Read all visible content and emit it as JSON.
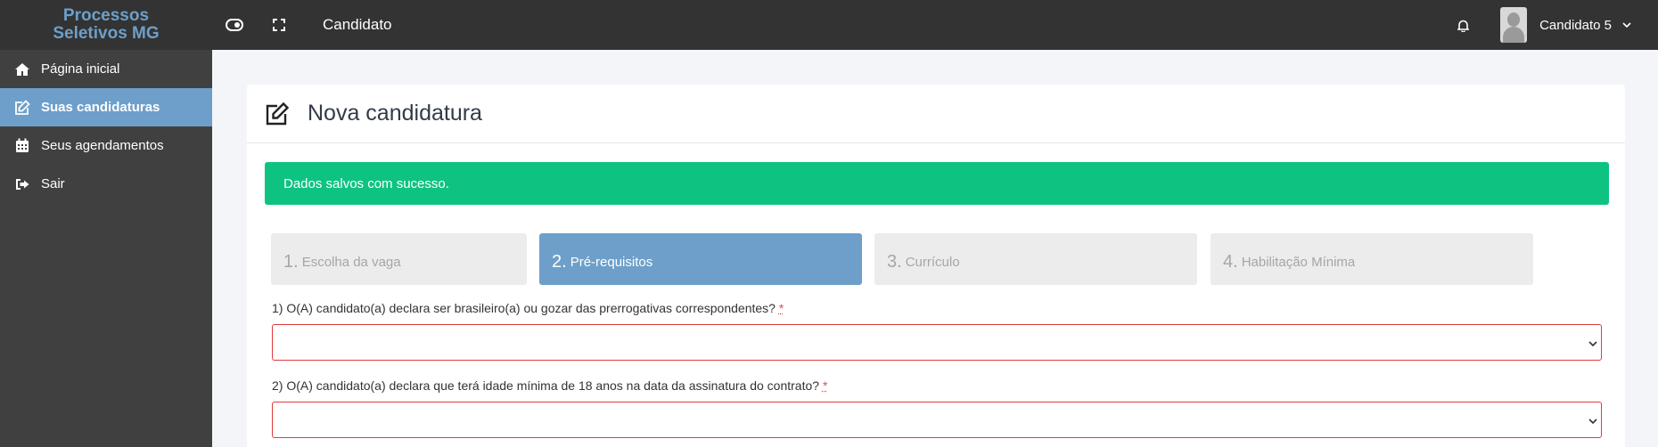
{
  "header": {
    "brand_line1": "Processos",
    "brand_line2": "Seletivos MG",
    "title": "Candidato",
    "user_name": "Candidato 5",
    "icons": [
      "toggle-sidebar-icon",
      "fullscreen-icon",
      "bell-icon",
      "chevron-down-icon"
    ]
  },
  "sidebar": {
    "items": [
      {
        "label": "Página inicial",
        "icon": "home-icon",
        "active": false
      },
      {
        "label": "Suas candidaturas",
        "icon": "edit-icon",
        "active": true
      },
      {
        "label": "Seus agendamentos",
        "icon": "calendar-icon",
        "active": false
      },
      {
        "label": "Sair",
        "icon": "sign-out-icon",
        "active": false
      }
    ]
  },
  "main": {
    "title": "Nova candidatura",
    "alert": "Dados salvos com sucesso.",
    "steps": [
      {
        "num": "1.",
        "label": "Escolha da vaga",
        "active": false
      },
      {
        "num": "2.",
        "label": "Pré-requisitos",
        "active": true
      },
      {
        "num": "3.",
        "label": "Currículo",
        "active": false
      },
      {
        "num": "4.",
        "label": "Habilitação Mínima",
        "active": false
      }
    ],
    "questions": [
      {
        "label": "1) O(A) candidato(a) declara ser brasileiro(a) ou gozar das prerrogativas correspondentes?",
        "required_mark": "*",
        "value": ""
      },
      {
        "label": "2) O(A) candidato(a) declara que terá idade mínima de 18 anos na data da assinatura do contrato?",
        "required_mark": "*",
        "value": ""
      }
    ]
  },
  "colors": {
    "topbar": "#333333",
    "sidebar": "#404040",
    "accent": "#6d9fca",
    "success": "#0ec382",
    "error_border": "#e23b3b"
  }
}
